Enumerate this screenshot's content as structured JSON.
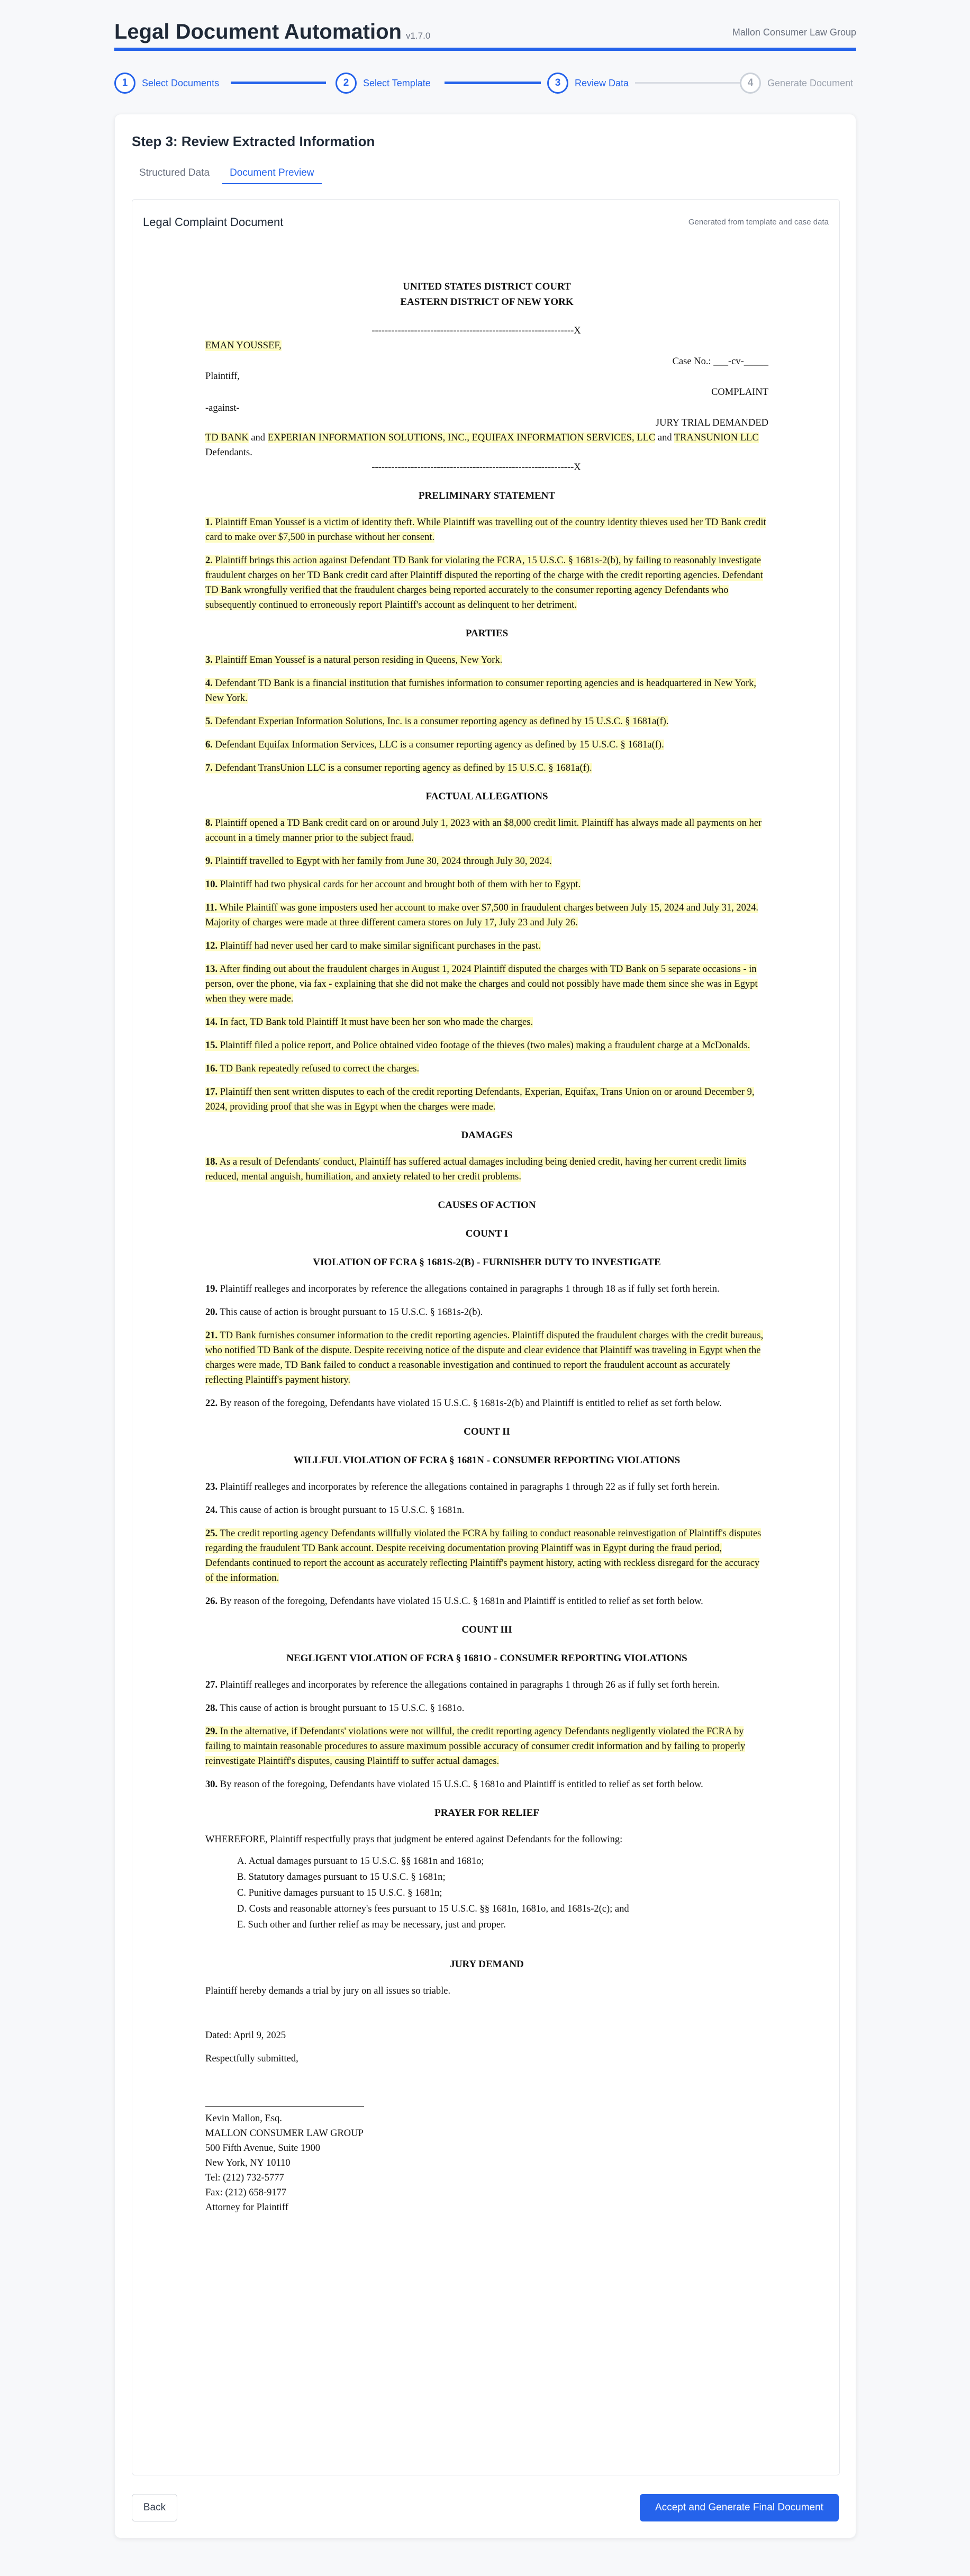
{
  "header": {
    "title": "Legal Document Automation",
    "version": "v1.7.0",
    "org": "Mallon Consumer Law Group"
  },
  "stepper": [
    {
      "num": "1",
      "label": "Select Documents",
      "state": "complete"
    },
    {
      "num": "2",
      "label": "Select Template",
      "state": "complete"
    },
    {
      "num": "3",
      "label": "Review Data",
      "state": "active"
    },
    {
      "num": "4",
      "label": "Generate Document",
      "state": "pending"
    }
  ],
  "card": {
    "title": "Step 3: Review Extracted Information"
  },
  "tabs": [
    {
      "label": "Structured Data",
      "active": false
    },
    {
      "label": "Document Preview",
      "active": true
    }
  ],
  "doc_panel": {
    "title": "Legal Complaint Document",
    "subtitle": "Generated from template and case data"
  },
  "complaint": {
    "court_line1": "UNITED STATES DISTRICT COURT",
    "court_line2": "EASTERN DISTRICT OF NEW YORK",
    "divider": "--------------------------------------------------------------X",
    "plaintiff_name": "EMAN YOUSSEF,",
    "case_no": "Case No.: ___-cv-_____",
    "plaintiff_label": "Plaintiff,",
    "complaint_label": "COMPLAINT",
    "against": "-against-",
    "jury_label": "JURY TRIAL DEMANDED",
    "defendants_hl1": "TD BANK",
    "defendants_and1": " and ",
    "defendants_hl2": "EXPERIAN INFORMATION SOLUTIONS, INC., EQUIFAX INFORMATION SERVICES, LLC",
    "defendants_and2": " and ",
    "defendants_hl3": "TRANSUNION LLC",
    "defendants_label": "Defendants.",
    "sections": [
      {
        "heading": "PRELIMINARY STATEMENT",
        "paras": [
          {
            "num": "1.",
            "text": "Plaintiff Eman Youssef is a victim of identity theft. While Plaintiff was travelling out of the country identity thieves used her TD Bank credit card to make over $7,500 in purchase without her consent.",
            "hl": true
          },
          {
            "num": "2.",
            "text": "Plaintiff brings this action against Defendant TD Bank for violating the FCRA, 15 U.S.C. § 1681s-2(b), by failing to reasonably investigate fraudulent charges on her TD Bank credit card after Plaintiff disputed the reporting of the charge with the credit reporting agencies. Defendant TD Bank wrongfully verified that the fraudulent charges being reported accurately to the consumer reporting agency Defendants who subsequently continued to erroneously report Plaintiff's account as delinquent to her detriment.",
            "hl": true
          }
        ]
      },
      {
        "heading": "PARTIES",
        "paras": [
          {
            "num": "3.",
            "text": "Plaintiff Eman Youssef is a natural person residing in Queens, New York.",
            "hl": true
          },
          {
            "num": "4.",
            "text": "Defendant TD Bank is a financial institution that furnishes information to consumer reporting agencies and is headquartered in New York, New York.",
            "hl": true
          },
          {
            "num": "5.",
            "text": "Defendant Experian Information Solutions, Inc. is a consumer reporting agency as defined by 15 U.S.C. § 1681a(f).",
            "hl": true
          },
          {
            "num": "6.",
            "text": "Defendant Equifax Information Services, LLC is a consumer reporting agency as defined by 15 U.S.C. § 1681a(f).",
            "hl": true
          },
          {
            "num": "7.",
            "text": "Defendant TransUnion LLC is a consumer reporting agency as defined by 15 U.S.C. § 1681a(f).",
            "hl": true
          }
        ]
      },
      {
        "heading": "FACTUAL ALLEGATIONS",
        "paras": [
          {
            "num": "8.",
            "text": "Plaintiff opened a TD Bank credit card on or around July 1, 2023 with an $8,000 credit limit. Plaintiff has always made all payments on her account in a timely manner prior to the subject fraud.",
            "hl": true
          },
          {
            "num": "9.",
            "text": "Plaintiff travelled to Egypt with her family from June 30, 2024 through July 30, 2024.",
            "hl": true
          },
          {
            "num": "10.",
            "text": "Plaintiff had two physical cards for her account and brought both of them with her to Egypt.",
            "hl": true
          },
          {
            "num": "11.",
            "text": "While Plaintiff was gone imposters used her account to make over $7,500 in fraudulent charges between July 15, 2024 and July 31, 2024. Majority of charges were made at three different camera stores on July 17, July 23 and July 26.",
            "hl": true
          },
          {
            "num": "12.",
            "text": "Plaintiff had never used her card to make similar significant purchases in the past.",
            "hl": true
          },
          {
            "num": "13.",
            "text": "After finding out about the fraudulent charges in August 1, 2024 Plaintiff disputed the charges with TD Bank on 5 separate occasions - in person, over the phone, via fax - explaining that she did not make the charges and could not possibly have made them since she was in Egypt when they were made.",
            "hl": true
          },
          {
            "num": "14.",
            "text": "In fact, TD Bank told Plaintiff It must have been her son who made the charges.",
            "hl": true
          },
          {
            "num": "15.",
            "text": "Plaintiff filed a police report, and Police obtained video footage of the thieves (two males) making a fraudulent charge at a McDonalds.",
            "hl": true
          },
          {
            "num": "16.",
            "text": "TD Bank repeatedly refused to correct the charges.",
            "hl": true
          },
          {
            "num": "17.",
            "text": "Plaintiff then sent written disputes to each of the credit reporting Defendants, Experian, Equifax, Trans Union on or around December 9, 2024, providing proof that she was in Egypt when the charges were made.",
            "hl": true
          }
        ]
      },
      {
        "heading": "DAMAGES",
        "paras": [
          {
            "num": "18.",
            "text": "As a result of Defendants' conduct, Plaintiff has suffered actual damages including being denied credit, having her current credit limits reduced, mental anguish, humiliation, and anxiety related to her credit problems.",
            "hl": true
          }
        ]
      },
      {
        "heading": "CAUSES OF ACTION",
        "paras": []
      },
      {
        "heading": "COUNT I",
        "paras": []
      },
      {
        "heading": "VIOLATION OF FCRA § 1681S-2(B) - FURNISHER DUTY TO INVESTIGATE",
        "paras": [
          {
            "num": "19.",
            "text": "Plaintiff realleges and incorporates by reference the allegations contained in paragraphs 1 through 18 as if fully set forth herein.",
            "hl": false
          },
          {
            "num": "20.",
            "text": "This cause of action is brought pursuant to 15 U.S.C. § 1681s-2(b).",
            "hl": false
          },
          {
            "num": "21.",
            "text": "TD Bank furnishes consumer information to the credit reporting agencies. Plaintiff disputed the fraudulent charges with the credit bureaus, who notified TD Bank of the dispute. Despite receiving notice of the dispute and clear evidence that Plaintiff was traveling in Egypt when the charges were made, TD Bank failed to conduct a reasonable investigation and continued to report the fraudulent account as accurately reflecting Plaintiff's payment history.",
            "hl": true
          },
          {
            "num": "22.",
            "text": "By reason of the foregoing, Defendants have violated 15 U.S.C. § 1681s-2(b) and Plaintiff is entitled to relief as set forth below.",
            "hl": false
          }
        ]
      },
      {
        "heading": "COUNT II",
        "paras": []
      },
      {
        "heading": "WILLFUL VIOLATION OF FCRA § 1681N - CONSUMER REPORTING VIOLATIONS",
        "paras": [
          {
            "num": "23.",
            "text": "Plaintiff realleges and incorporates by reference the allegations contained in paragraphs 1 through 22 as if fully set forth herein.",
            "hl": false
          },
          {
            "num": "24.",
            "text": "This cause of action is brought pursuant to 15 U.S.C. § 1681n.",
            "hl": false
          },
          {
            "num": "25.",
            "text": "The credit reporting agency Defendants willfully violated the FCRA by failing to conduct reasonable reinvestigation of Plaintiff's disputes regarding the fraudulent TD Bank account. Despite receiving documentation proving Plaintiff was in Egypt during the fraud period, Defendants continued to report the account as accurately reflecting Plaintiff's payment history, acting with reckless disregard for the accuracy of the information.",
            "hl": true
          },
          {
            "num": "26.",
            "text": "By reason of the foregoing, Defendants have violated 15 U.S.C. § 1681n and Plaintiff is entitled to relief as set forth below.",
            "hl": false
          }
        ]
      },
      {
        "heading": "COUNT III",
        "paras": []
      },
      {
        "heading": "NEGLIGENT VIOLATION OF FCRA § 1681O - CONSUMER REPORTING VIOLATIONS",
        "paras": [
          {
            "num": "27.",
            "text": "Plaintiff realleges and incorporates by reference the allegations contained in paragraphs 1 through 26 as if fully set forth herein.",
            "hl": false
          },
          {
            "num": "28.",
            "text": "This cause of action is brought pursuant to 15 U.S.C. § 1681o.",
            "hl": false
          },
          {
            "num": "29.",
            "text": "In the alternative, if Defendants' violations were not willful, the credit reporting agency Defendants negligently violated the FCRA by failing to maintain reasonable procedures to assure maximum possible accuracy of consumer credit information and by failing to properly reinvestigate Plaintiff's disputes, causing Plaintiff to suffer actual damages.",
            "hl": true
          },
          {
            "num": "30.",
            "text": "By reason of the foregoing, Defendants have violated 15 U.S.C. § 1681o and Plaintiff is entitled to relief as set forth below.",
            "hl": false
          }
        ]
      }
    ],
    "prayer_heading": "PRAYER FOR RELIEF",
    "prayer_intro": "WHEREFORE, Plaintiff respectfully prays that judgment be entered against Defendants for the following:",
    "prayer_items": [
      "A. Actual damages pursuant to 15 U.S.C. §§ 1681n and 1681o;",
      "B. Statutory damages pursuant to 15 U.S.C. § 1681n;",
      "C. Punitive damages pursuant to 15 U.S.C. § 1681n;",
      "D. Costs and reasonable attorney's fees pursuant to 15 U.S.C. §§ 1681n, 1681o, and 1681s-2(c); and",
      "E. Such other and further relief as may be necessary, just and proper."
    ],
    "jury_heading": "JURY DEMAND",
    "jury_text": "Plaintiff hereby demands a trial by jury on all issues so triable.",
    "dated": "Dated: April 9, 2025",
    "submitted": "Respectfully submitted,",
    "signature": [
      "Kevin Mallon, Esq.",
      "MALLON CONSUMER LAW GROUP",
      "500 Fifth Avenue, Suite 1900",
      "New York, NY 10110",
      "Tel: (212) 732-5777",
      "Fax: (212) 658-9177",
      "Attorney for Plaintiff"
    ]
  },
  "actions": {
    "back_label": "Back",
    "accept_label": "Accept and Generate Final Document"
  }
}
